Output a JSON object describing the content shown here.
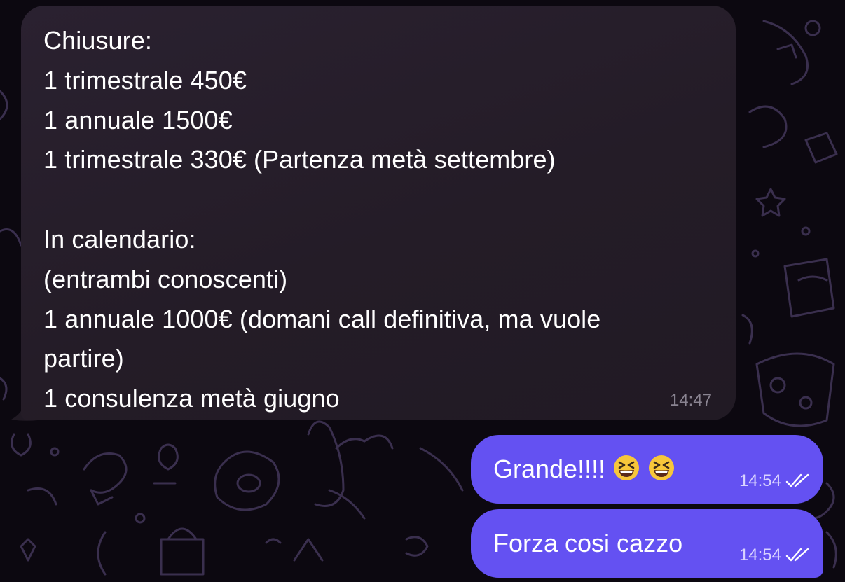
{
  "incoming": {
    "lines": [
      "Chiusure:",
      "1 trimestrale 450€",
      "1 annuale 1500€",
      "1 trimestrale 330€ (Partenza metà settembre)",
      "",
      "In calendario:",
      "(entrambi conoscenti)",
      "1 annuale 1000€ (domani call definitiva, ma vuole",
      "partire)",
      "1 consulenza metà giugno"
    ],
    "time": "14:47"
  },
  "outgoing": [
    {
      "text": "Grande!!!!",
      "emoji": [
        "grinning-squinting-face",
        "grinning-squinting-face"
      ],
      "time": "14:54",
      "status": "read-double-check"
    },
    {
      "text": "Forza cosi cazzo",
      "time": "14:54",
      "status": "read-double-check"
    }
  ],
  "colors": {
    "background": "#0c0810",
    "incoming_bubble": "#261e29",
    "outgoing_bubble": "#6451f2",
    "doodle": "#3a2f4e"
  }
}
